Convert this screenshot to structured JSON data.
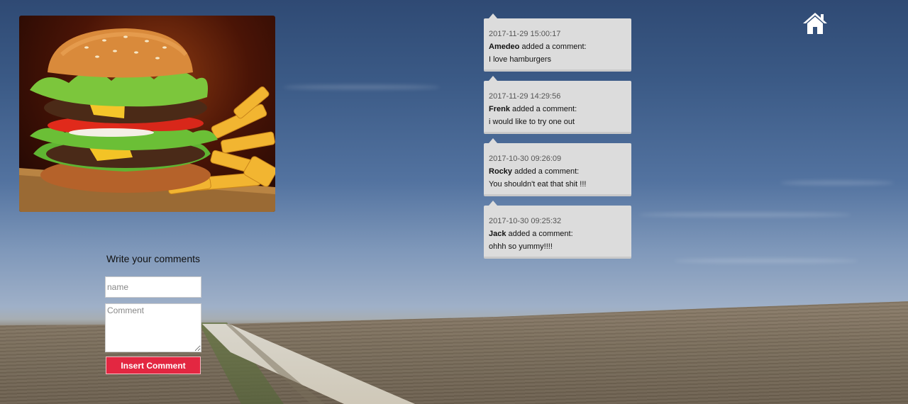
{
  "form": {
    "title": "Write your comments",
    "name_placeholder": "name",
    "comment_placeholder": "Comment",
    "submit_label": "Insert Comment"
  },
  "comments": [
    {
      "date": "2017-11-29 15:00:17",
      "author": "Amedeo",
      "action": "added a comment:",
      "text": "I love hamburgers"
    },
    {
      "date": "2017-11-29 14:29:56",
      "author": "Frenk",
      "action": "added a comment:",
      "text": "i would like to try one out"
    },
    {
      "date": "2017-10-30 09:26:09",
      "author": "Rocky",
      "action": "added a comment:",
      "text": "You shouldn't eat that shit !!!"
    },
    {
      "date": "2017-10-30 09:25:32",
      "author": "Jack",
      "action": "added a comment:",
      "text": "ohhh so yummy!!!!"
    }
  ],
  "icons": {
    "home": "home-icon"
  },
  "colors": {
    "button": "#e32741",
    "comment_bg": "#dcdcdc"
  }
}
